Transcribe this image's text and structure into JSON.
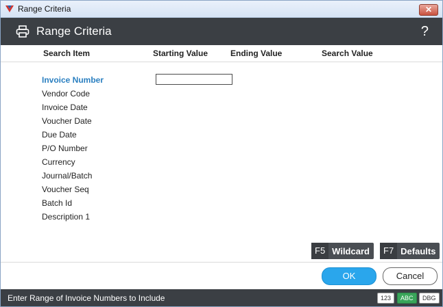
{
  "window": {
    "title": "Range Criteria",
    "close_glyph": "✕"
  },
  "header": {
    "title": "Range Criteria",
    "help_glyph": "?"
  },
  "columns": [
    "Search Item",
    "Starting Value",
    "Ending Value",
    "Search Value"
  ],
  "search_items": [
    "Invoice Number",
    "Vendor Code",
    "Invoice Date",
    "Voucher Date",
    "Due Date",
    "P/O Number",
    "Currency",
    "Journal/Batch",
    "Voucher Seq",
    "Batch Id",
    "Description 1"
  ],
  "active_item_index": 0,
  "starting_value": "",
  "function_keys": [
    {
      "key": "F5",
      "label": "Wildcard"
    },
    {
      "key": "F7",
      "label": "Defaults"
    }
  ],
  "buttons": {
    "ok": "OK",
    "cancel": "Cancel"
  },
  "status": {
    "message": "Enter Range of Invoice Numbers to Include",
    "badges": [
      {
        "text": "123",
        "active": false
      },
      {
        "text": "ABC",
        "active": true
      },
      {
        "text": "DBG",
        "active": false
      }
    ]
  },
  "colors": {
    "header_bg": "#3b3f44",
    "accent": "#2aa6ec",
    "active_item": "#2a7fc0",
    "badge_active": "#3aa55a"
  }
}
